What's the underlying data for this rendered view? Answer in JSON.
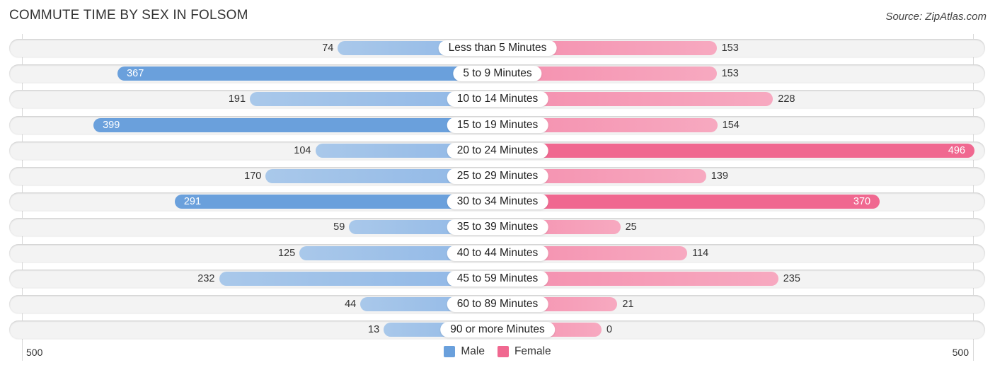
{
  "title": "COMMUTE TIME BY SEX IN FOLSOM",
  "source": "Source: ZipAtlas.com",
  "colors": {
    "male_strong": "#6aa0dc",
    "male_light": "#a9c8ea",
    "female_strong": "#f06890",
    "female_light": "#f7a9c0"
  },
  "chart_data": {
    "type": "bar",
    "orientation": "horizontal-diverging",
    "title": "COMMUTE TIME BY SEX IN FOLSOM",
    "categories": [
      "Less than 5 Minutes",
      "5 to 9 Minutes",
      "10 to 14 Minutes",
      "15 to 19 Minutes",
      "20 to 24 Minutes",
      "25 to 29 Minutes",
      "30 to 34 Minutes",
      "35 to 39 Minutes",
      "40 to 44 Minutes",
      "45 to 59 Minutes",
      "60 to 89 Minutes",
      "90 or more Minutes"
    ],
    "series": [
      {
        "name": "Male",
        "side": "left",
        "values": [
          74,
          367,
          191,
          399,
          104,
          170,
          291,
          59,
          125,
          232,
          44,
          13
        ]
      },
      {
        "name": "Female",
        "side": "right",
        "values": [
          153,
          153,
          228,
          154,
          496,
          139,
          370,
          25,
          114,
          235,
          21,
          0
        ]
      }
    ],
    "axis": {
      "left_label": "500",
      "right_label": "500",
      "range": [
        0,
        500
      ]
    },
    "legend": {
      "position": "bottom-center",
      "entries": [
        "Male",
        "Female"
      ]
    },
    "grid": false
  }
}
